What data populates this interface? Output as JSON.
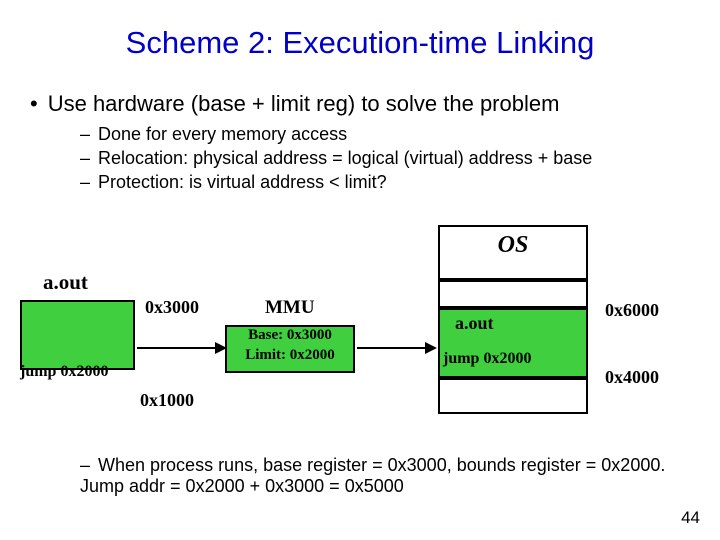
{
  "title": "Scheme 2: Execution-time Linking",
  "bullets": {
    "main": "Use hardware (base + limit reg) to solve the problem",
    "sub": [
      "Done for every memory access",
      "Relocation: physical address = logical (virtual) address + base",
      "Protection: is virtual address < limit?"
    ],
    "bottom": "When process runs, base register = 0x3000, bounds register = 0x2000.  Jump addr = 0x2000 + 0x3000 = 0x5000"
  },
  "diagram": {
    "aout": "a.out",
    "jump": "jump 0x2000",
    "addr_3000": "0x3000",
    "addr_1000": "0x1000",
    "mmu_title": "MMU",
    "mmu_base": "Base: 0x3000",
    "mmu_limit": "Limit: 0x2000",
    "os_label": "OS",
    "right_aout": "a.out",
    "right_jump": "jump 0x2000",
    "addr_6000": "0x6000",
    "addr_4000": "0x4000"
  },
  "slidenum": "44"
}
